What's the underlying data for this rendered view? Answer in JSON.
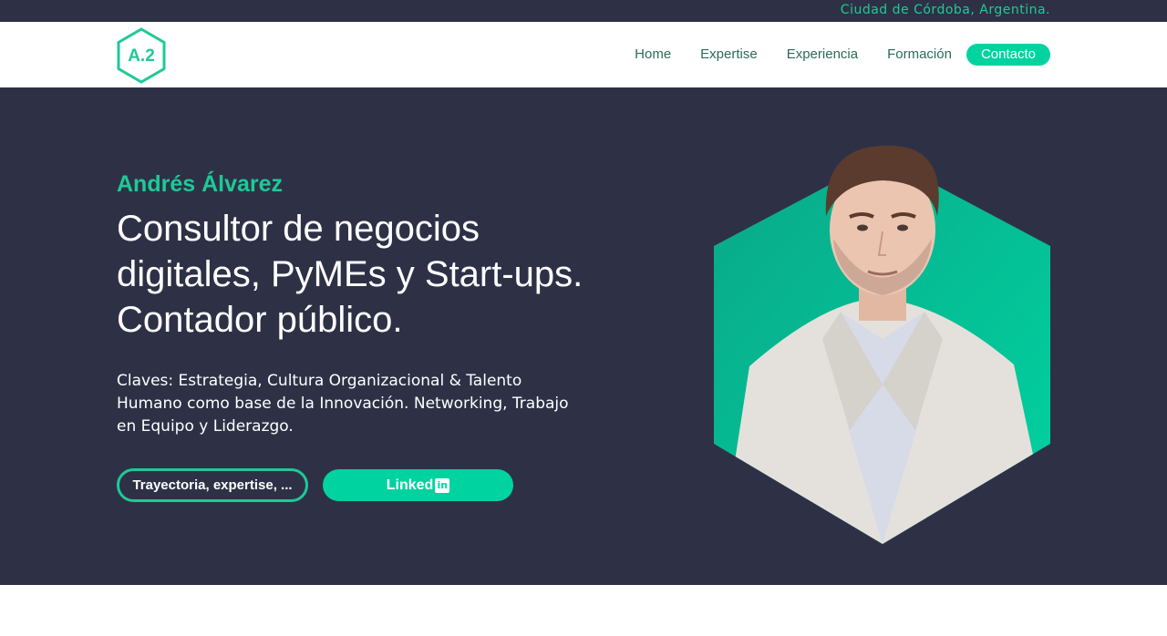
{
  "topbar": {
    "location": "Ciudad de Córdoba, Argentina."
  },
  "brand": {
    "logo_text": "A.2"
  },
  "nav": {
    "items": [
      "Home",
      "Expertise",
      "Experiencia",
      "Formación"
    ],
    "cta": "Contacto"
  },
  "hero": {
    "name": "Andrés Álvarez",
    "headline_lines": [
      "Consultor de negocios",
      "digitales, PyMEs y Start-ups.",
      "Contador público."
    ],
    "description": "Claves: Estrategia, Cultura Organizacional & Talento Humano como base de la Innovación. Networking, Trabajo en Equipo y Liderazgo.",
    "primary_button": "Trayectoria, expertise, ...",
    "linkedin_button": "Linked",
    "linkedin_badge": "in"
  },
  "colors": {
    "accent": "#00d3a0",
    "dark": "#2e3146",
    "nav_text": "#2c6b5a"
  },
  "icons": [
    "logo-hexagon-icon",
    "linkedin-icon"
  ]
}
